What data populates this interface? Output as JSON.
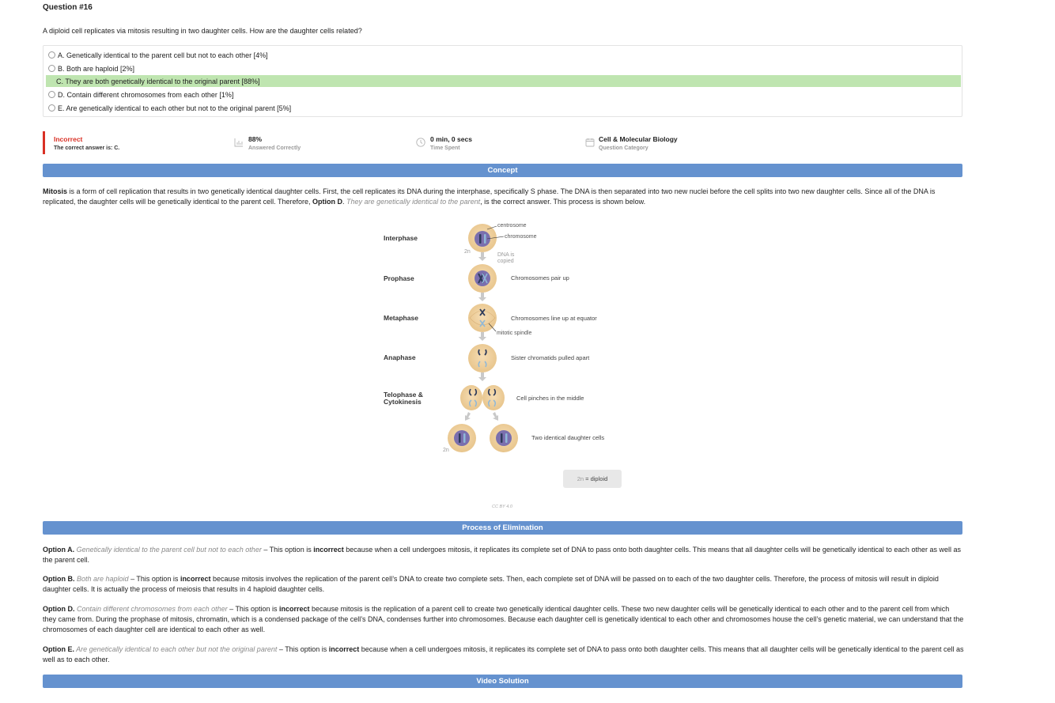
{
  "question": {
    "number": "Question #16",
    "text": "A diploid cell replicates via mitosis resulting in two daughter cells. How are the daughter cells related?"
  },
  "options": [
    {
      "label": "A. Genetically identical to the parent cell but not to each other [4%]",
      "correct": false
    },
    {
      "label": "B. Both are haploid [2%]",
      "correct": false
    },
    {
      "label": "C. They are both genetically identical to the original parent [88%]",
      "correct": true
    },
    {
      "label": "D. Contain different chromosomes from each other [1%]",
      "correct": false
    },
    {
      "label": "E. Are genetically identical to each other but not to the original parent [5%]",
      "correct": false
    }
  ],
  "stats": {
    "result": "Incorrect",
    "correct_answer": "The correct answer is: C.",
    "percent": "88%",
    "percent_label": "Answered Correctly",
    "time": "0 min, 0 secs",
    "time_label": "Time Spent",
    "category": "Cell & Molecular Biology",
    "category_label": "Question Category"
  },
  "sections": {
    "concept": "Concept",
    "elimination": "Process of Elimination",
    "video": "Video Solution"
  },
  "concept": {
    "term": "Mitosis",
    "text1": " is a form of cell replication that results in two genetically identical daughter cells. First, the cell replicates its DNA during the interphase, specifically S phase. The DNA is then separated into two new nuclei before the cell splits into two new daughter cells. Since all of the DNA is replicated, the daughter cells will be genetically identical to the parent cell. Therefore, ",
    "option": "Option D",
    "dot": ". ",
    "italic": "They are genetically identical to the parent",
    "text2": ", is the correct answer. This process is shown below."
  },
  "diagram": {
    "phases": [
      "Interphase",
      "Prophase",
      "Metaphase",
      "Anaphase",
      "Telophase &",
      "Cytokinesis"
    ],
    "descriptions": [
      "Chromosomes pair up",
      "Chromosomes line up at equator",
      "Sister chromatids pulled apart",
      "Cell pinches in the middle",
      "Two identical daughter cells"
    ],
    "annotations": {
      "centrosome": "centrosome",
      "chromosome": "chromosome",
      "dna1": "DNA is",
      "dna2": "copied",
      "spindle": "mitotic spindle",
      "two_n": "2n"
    },
    "legend_n": "2n",
    "legend_text": " = diploid",
    "license": "CC BY 4.0",
    "colors": {
      "cell": "#efcf9c",
      "nucleus": "#7a6fae",
      "chromosome": "#2d3a5a",
      "chromatid_blue": "#8fb8d8",
      "arrow": "#c8c8c8"
    }
  },
  "elimination": [
    {
      "option": "Option A.",
      "italic": " Genetically identical to the parent cell but not to each other",
      "pre": " – This option is ",
      "bold": "incorrect",
      "text": " because when a cell undergoes mitosis, it replicates its complete set of DNA to pass onto both daughter cells. This means that all daughter cells will be genetically identical to each other as well as the parent cell."
    },
    {
      "option": "Option B.",
      "italic": " Both are haploid",
      "pre": " – This option is ",
      "bold": "incorrect",
      "text": " because mitosis involves the replication of the parent cell’s DNA to create two complete sets. Then, each complete set of DNA will be passed on to each of the two daughter cells. Therefore, the process of mitosis will result in diploid daughter cells. It is actually the process of meiosis that results in 4 haploid daughter cells."
    },
    {
      "option": "Option D.",
      "italic": " Contain different chromosomes from each other",
      "pre": " – This option is ",
      "bold": "incorrect",
      "text": " because mitosis is the replication of a parent cell to create two genetically identical daughter cells. These two new daughter cells will be genetically identical to each other and to the parent cell from which they came from. During the prophase of mitosis, chromatin, which is a condensed package of the cell’s DNA, condenses further into chromosomes. Because each daughter cell is genetically identical to each other and chromosomes house the cell’s genetic material, we can understand that the chromosomes of each daughter cell are identical to each other as well."
    },
    {
      "option": "Option E.",
      "italic": " Are genetically identical to each other but not the original parent",
      "pre": " – This option is ",
      "bold": "incorrect",
      "text": " because when a cell undergoes mitosis, it replicates its complete set of DNA to pass onto both daughter cells. This means that all daughter cells will be genetically identical to the parent cell as well as to each other."
    }
  ]
}
